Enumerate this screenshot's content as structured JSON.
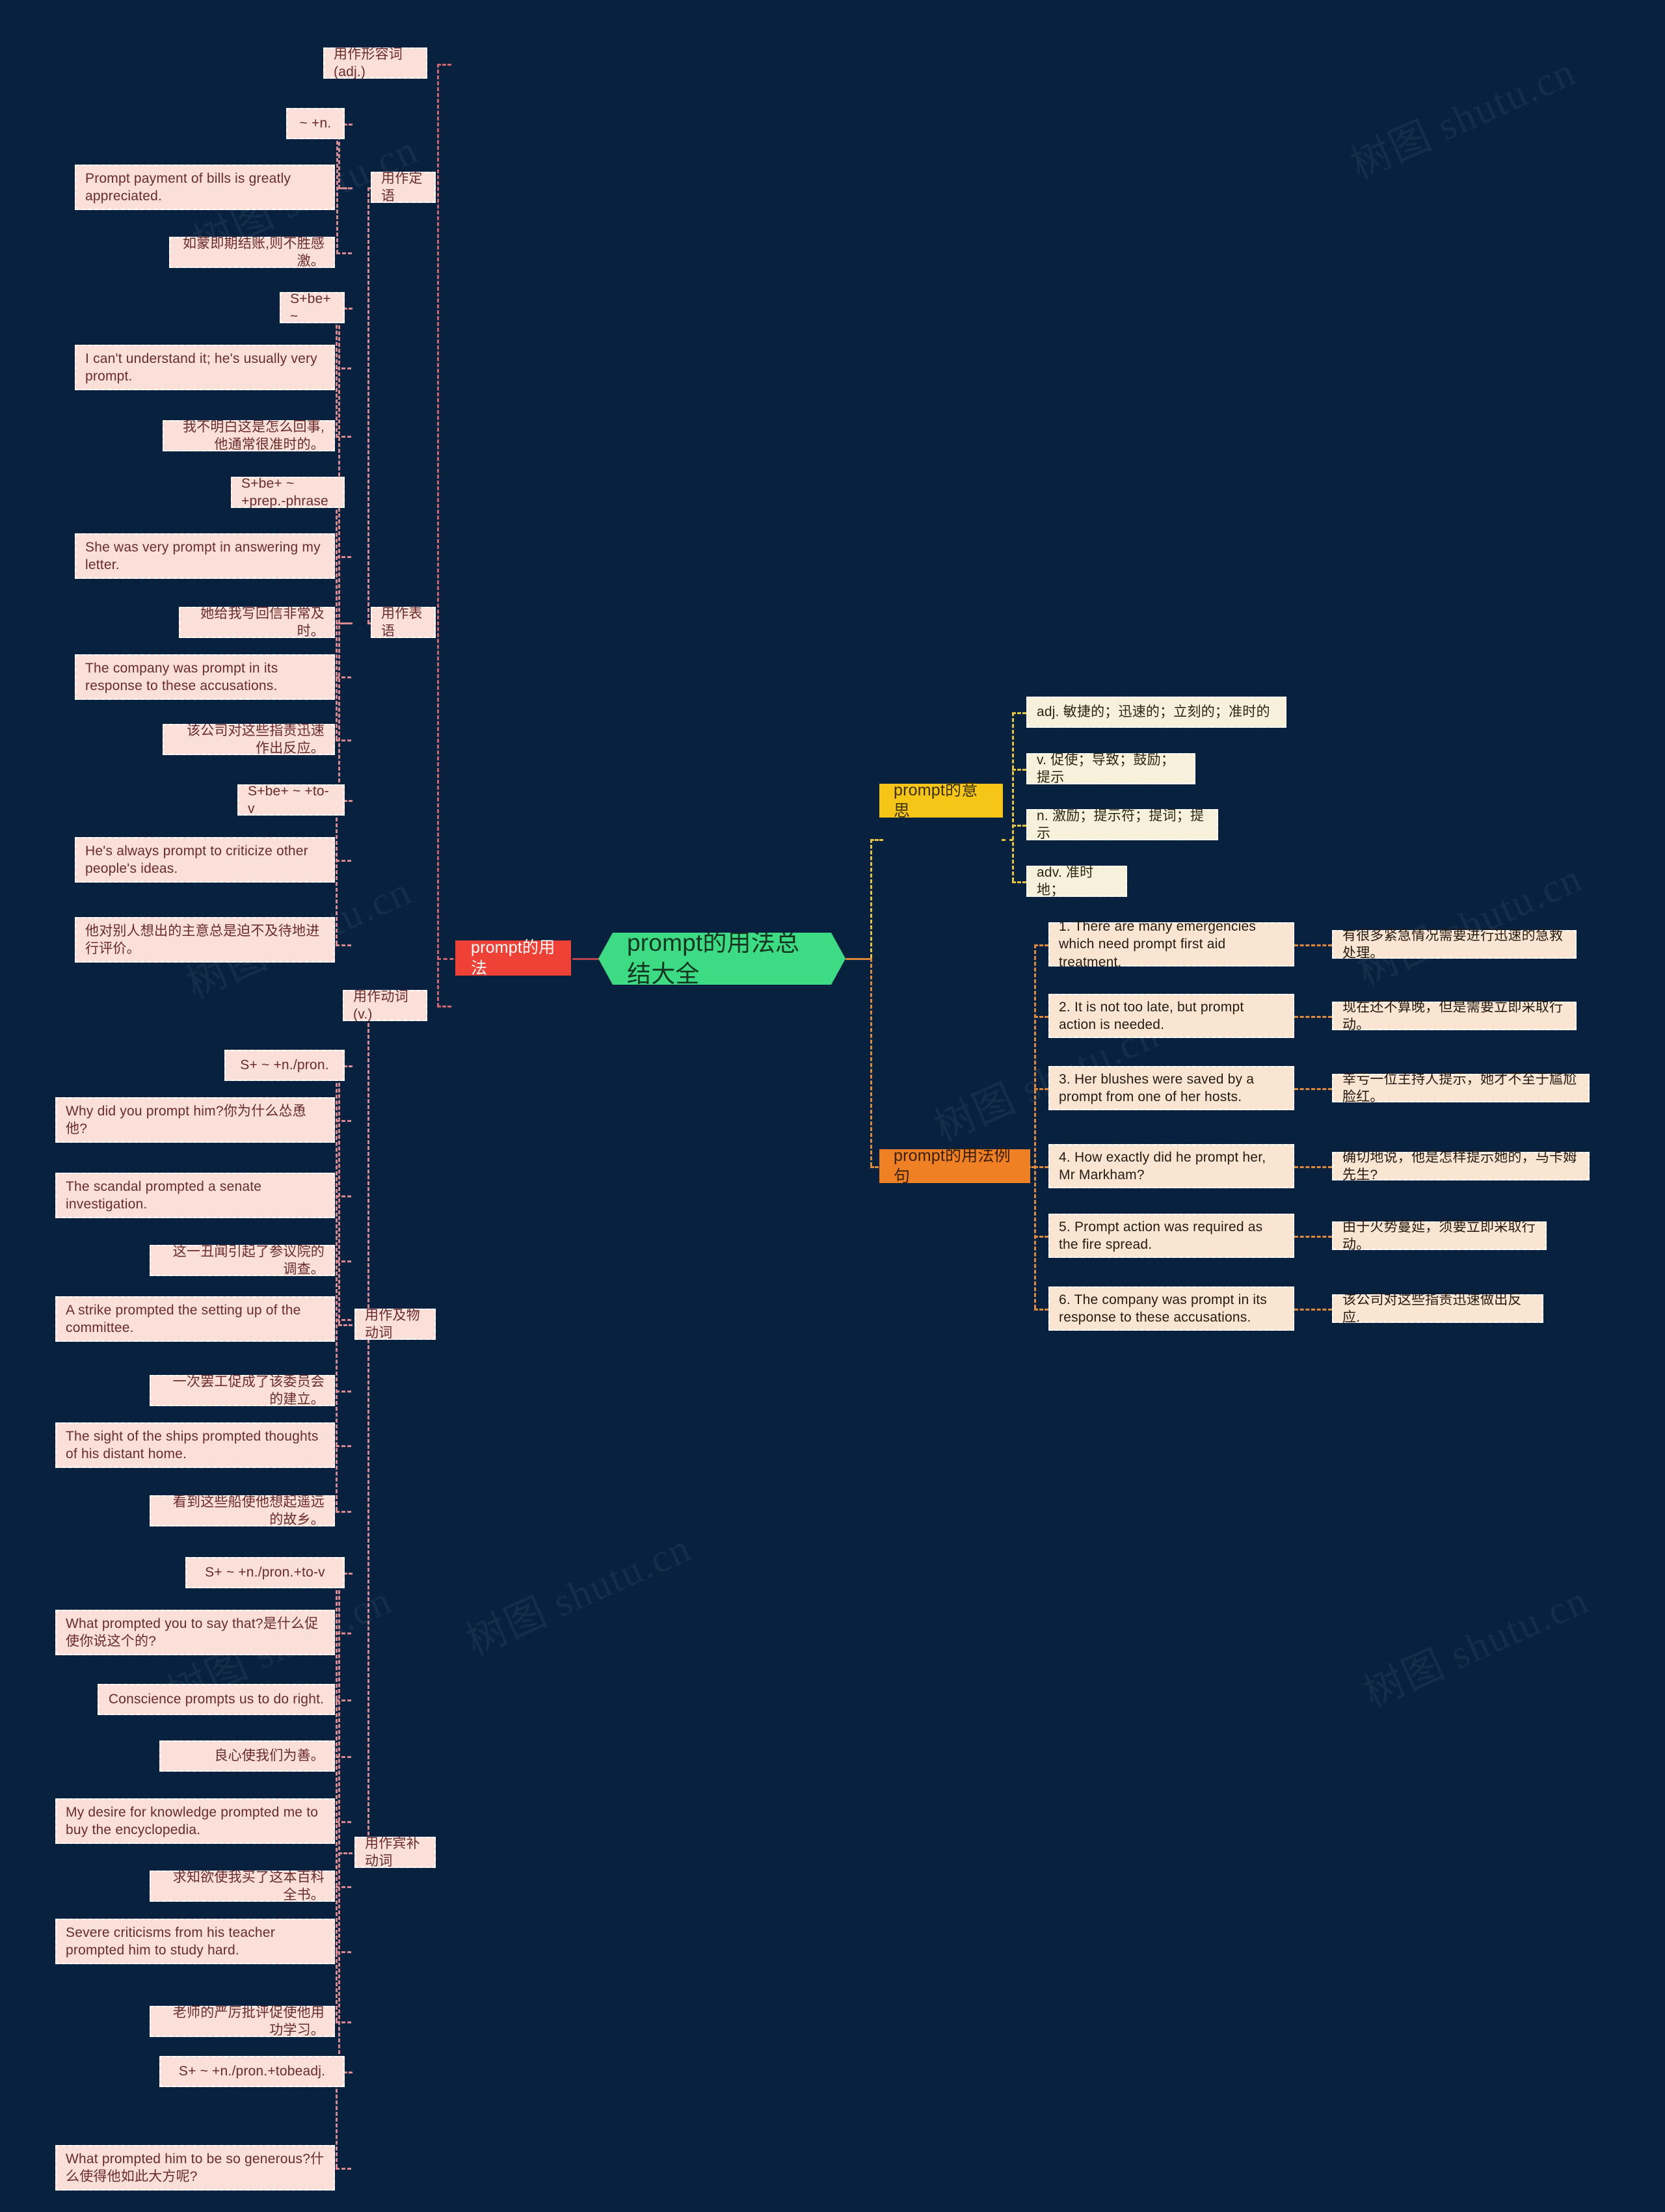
{
  "meta": {
    "title": "prompt的用法总结大全",
    "background_color": "#07213f",
    "watermark_text": "树图 shutu.cn"
  },
  "root": {
    "label": "prompt的用法总结大全",
    "color": "#3ddc84"
  },
  "branches": {
    "usage": {
      "label": "prompt的用法",
      "color": "#ef4136",
      "groups": [
        {
          "label": "用作形容词(adj.)",
          "subgroups": [
            {
              "label": "用作定语",
              "patterns": [
                {
                  "pattern": "~ +n.",
                  "examples": [
                    "Prompt payment of bills is greatly appreciated.",
                    "如蒙即期结账,则不胜感激。"
                  ]
                }
              ]
            },
            {
              "label": "用作表语",
              "patterns": [
                {
                  "pattern": "S+be+ ~",
                  "examples": [
                    "I can't understand it; he's usually very prompt.",
                    "我不明白这是怎么回事,他通常很准时的。"
                  ]
                },
                {
                  "pattern": "S+be+ ~ +prep.-phrase",
                  "examples": [
                    "She was very prompt in answering my letter.",
                    "她给我写回信非常及时。",
                    "The company was prompt in its response to these accusations.",
                    "该公司对这些指责迅速作出反应。"
                  ]
                },
                {
                  "pattern": "S+be+ ~ +to-v",
                  "examples": [
                    "He's always prompt to criticize other people's ideas.",
                    "他对别人想出的主意总是迫不及待地进行评价。"
                  ]
                }
              ]
            }
          ]
        },
        {
          "label": "用作动词(v.)",
          "subgroups": [
            {
              "label": "用作及物动词",
              "patterns": [
                {
                  "pattern": "S+ ~ +n./pron.",
                  "examples": [
                    "Why did you prompt him?你为什么怂恿他?",
                    "The scandal prompted a senate investigation.",
                    "这一丑闻引起了参议院的调查。",
                    "A strike prompted the setting up of the committee.",
                    "一次罢工促成了该委员会的建立。",
                    "The sight of the ships prompted thoughts of his distant home.",
                    "看到这些船使他想起遥远的故乡。"
                  ]
                }
              ]
            },
            {
              "label": "用作宾补动词",
              "patterns": [
                {
                  "pattern": "S+ ~ +n./pron.+to-v",
                  "examples": [
                    "What prompted you to say that?是什么促使你说这个的?",
                    "Conscience prompts us to do right.",
                    "良心使我们为善。",
                    "My desire for knowledge prompted me to buy the encyclopedia.",
                    "求知欲使我买了这本百科全书。",
                    "Severe criticisms from his teacher prompted him to study hard.",
                    "老师的严厉批评促使他用功学习。"
                  ]
                },
                {
                  "pattern": "S+ ~ +n./pron.+tobeadj.",
                  "examples": [
                    "What prompted him to be so generous?什么使得他如此大方呢?"
                  ]
                }
              ]
            }
          ]
        }
      ]
    },
    "meaning": {
      "label": "prompt的意思",
      "color": "#f5c518",
      "items": [
        "adj. 敏捷的；迅速的；立刻的；准时的",
        "v. 促使；导致；鼓励；提示",
        "n. 激励；提示符；提词；提示",
        "adv. 准时地；"
      ]
    },
    "examples": {
      "label": "prompt的用法例句",
      "color": "#ef8023",
      "items": [
        {
          "en": "1. There are many emergencies which need prompt first aid treatment.",
          "zh": "有很多紧急情况需要进行迅速的急救处理。"
        },
        {
          "en": "2. It is not too late, but prompt action is needed.",
          "zh": "现在还不算晚，但是需要立即采取行动。"
        },
        {
          "en": "3. Her blushes were saved by a prompt from one of her hosts.",
          "zh": "幸亏一位主持人提示，她才不至于尴尬脸红。"
        },
        {
          "en": "4. How exactly did he prompt her, Mr Markham?",
          "zh": "确切地说，他是怎样提示她的，马卡姆先生?"
        },
        {
          "en": "5. Prompt action was required as the fire spread.",
          "zh": "由于火势蔓延，须要立即采取行动。"
        },
        {
          "en": "6. The company was prompt in its response to these accusations.",
          "zh": "该公司对这些指责迅速做出反应."
        }
      ]
    }
  }
}
